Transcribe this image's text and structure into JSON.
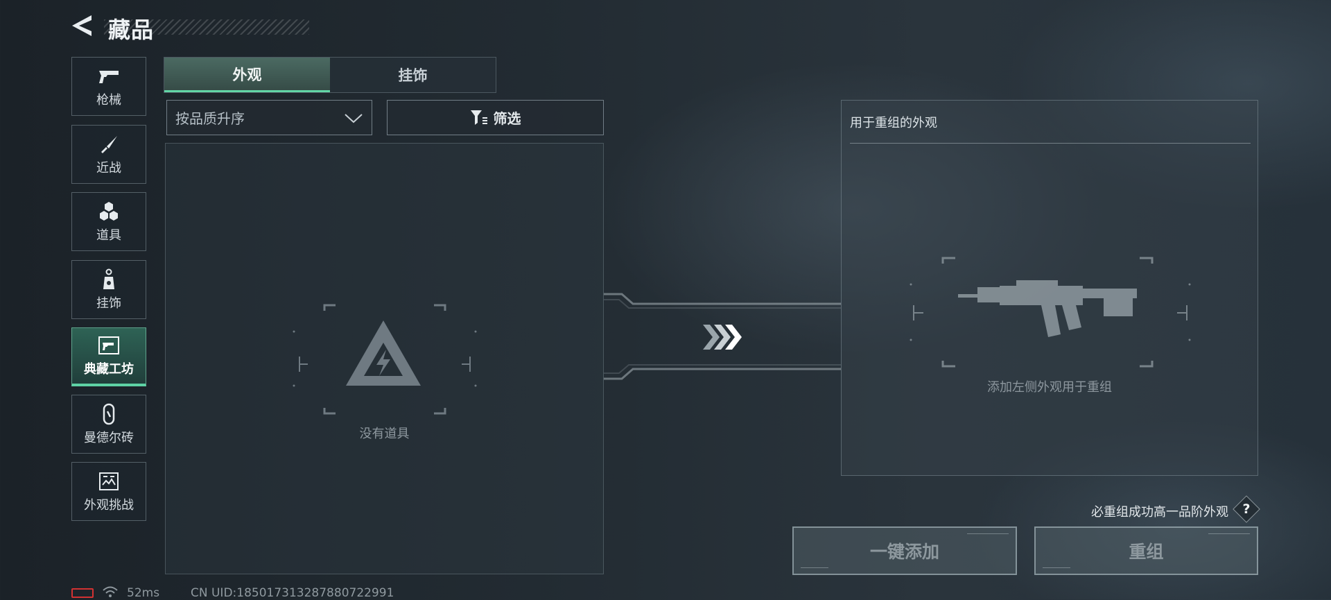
{
  "header": {
    "title": "藏品"
  },
  "sidebar": {
    "items": [
      {
        "label": "枪械",
        "icon": "pistol-icon"
      },
      {
        "label": "近战",
        "icon": "knife-icon"
      },
      {
        "label": "道具",
        "icon": "grenades-icon"
      },
      {
        "label": "挂饰",
        "icon": "charm-icon"
      },
      {
        "label": "典藏工坊",
        "icon": "workshop-icon",
        "active": true
      },
      {
        "label": "曼德尔砖",
        "icon": "brick-icon"
      },
      {
        "label": "外观挑战",
        "icon": "challenge-icon"
      }
    ]
  },
  "tabs": [
    {
      "label": "外观",
      "active": true
    },
    {
      "label": "挂饰",
      "active": false
    }
  ],
  "sort": {
    "label": "按品质升序"
  },
  "filter": {
    "label": "筛选"
  },
  "list": {
    "empty_text": "没有道具"
  },
  "right_panel": {
    "title": "用于重组的外观",
    "hint": "添加左侧外观用于重组"
  },
  "footer": {
    "rule_text": "必重组成功高一品阶外观",
    "help_label": "?",
    "add_all_label": "一键添加",
    "reform_label": "重组"
  },
  "status": {
    "ping": "52ms",
    "uid": "CN UID:1850173132878807​22991"
  },
  "colors": {
    "accent": "#5ed3a5",
    "battery_low": "#d23232"
  }
}
